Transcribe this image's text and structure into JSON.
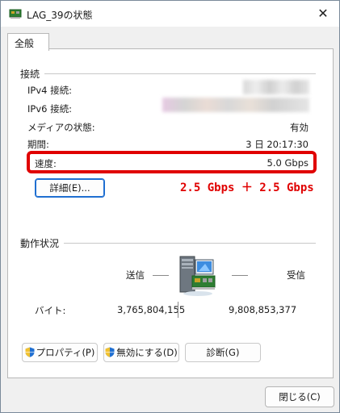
{
  "window": {
    "title": "LAG_39の状態",
    "close_glyph": "✕"
  },
  "tabs": [
    {
      "label": "全般",
      "active": true
    }
  ],
  "connection": {
    "group_label": "接続",
    "rows": [
      {
        "label": "IPv4 接続:",
        "value": ""
      },
      {
        "label": "IPv6 接続:",
        "value": ""
      },
      {
        "label": "メディアの状態:",
        "value": "有効"
      },
      {
        "label": "期間:",
        "value": "3 日 20:17:30"
      },
      {
        "label": "速度:",
        "value": "5.0 Gbps"
      }
    ],
    "details_button": "詳細(E)...",
    "annotation": "2.5 Gbps ＋ 2.5 Gbps"
  },
  "activity": {
    "group_label": "動作状況",
    "sent_label": "送信",
    "received_label": "受信",
    "bytes_label": "バイト:",
    "bytes_sent": "3,765,804,155",
    "bytes_received": "9,808,853,377",
    "dash": "—"
  },
  "buttons": {
    "properties": "プロパティ(P)",
    "disable": "無効にする(D)",
    "diagnose": "診断(G)",
    "close": "閉じる(C)"
  },
  "colors": {
    "highlight": "#e00000",
    "annotation": "#e00000",
    "accent": "#1f6fd1"
  }
}
